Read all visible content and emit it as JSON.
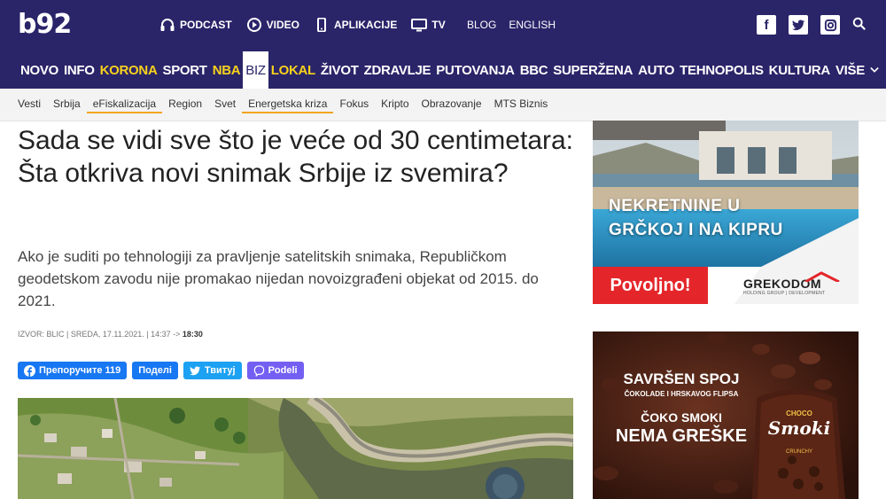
{
  "header": {
    "logo": "b92",
    "top_links": [
      {
        "label": "PODCAST",
        "icon": "headphones-icon"
      },
      {
        "label": "VIDEO",
        "icon": "play-icon"
      },
      {
        "label": "APLIKACIJE",
        "icon": "phone-icon"
      },
      {
        "label": "TV",
        "icon": "tv-icon"
      }
    ],
    "blog": "BLOG",
    "english": "ENGLISH",
    "social": [
      "facebook-icon",
      "twitter-icon",
      "instagram-icon",
      "search-icon"
    ]
  },
  "main_nav": {
    "items": [
      "NOVO",
      "INFO",
      "KORONA",
      "SPORT",
      "NBA",
      "BIZ",
      "LOKAL",
      "ŽIVOT",
      "ZDRAVLJE",
      "PUTOVANJA",
      "BBC",
      "SUPERŽENA",
      "AUTO",
      "TEHNOPOLIS",
      "KULTURA",
      "VIŠE"
    ],
    "active": "BIZ",
    "highlighted": [
      "KORONA",
      "NBA",
      "LOKAL"
    ]
  },
  "sub_nav": {
    "items": [
      "Vesti",
      "Srbija",
      "eFiskalizacija",
      "Region",
      "Svet",
      "Energetska kriza",
      "Fokus",
      "Kripto",
      "Obrazovanje",
      "MTS Biznis"
    ],
    "highlighted": [
      "eFiskalizacija",
      "Energetska kriza"
    ]
  },
  "article": {
    "title": "Sada se vidi sve što je veće od 30 centimetara: Šta otkriva novi snimak Srbije iz svemira?",
    "lead": "Ako je suditi po tehnologiji za pravljenje satelitskih snimaka, Republičkom geodetskom zavodu nije promakao nijedan novoizgrađeni objekat od 2015. do 2021.",
    "meta_prefix": "IZVOR: BLIC | SREDA, 17.11.2021. | 14:37 ->",
    "meta_time": "18:30"
  },
  "share": {
    "recommend": "Препоручите 119",
    "share": "Поделi",
    "tweet": "Твитуј",
    "viber": "Podeli"
  },
  "ads": {
    "ad1": {
      "line1": "NEKRETNINE U",
      "line2": "GRČKOJ I NA KIPRU",
      "cta": "Povoljno!",
      "brand": "GREKODOM",
      "brand_sub": "HOLDING GROUP | DEVELOPMENT"
    },
    "ad2": {
      "line1": "SAVRŠEN SPOJ",
      "line2": "ČOKOLADE I HRSKAVOG FLIPSA",
      "line3": "ČOKO SMOKI",
      "line4": "NEMA GREŠKE",
      "pack_top": "CHOCO",
      "pack_brand": "Smoki",
      "pack_sub": "CRUNCHY"
    }
  },
  "colors": {
    "header_bg": "#2a2469",
    "accent_yellow": "#f8d21c",
    "underline_orange": "#f2a51a",
    "ad_red": "#e4262b"
  }
}
